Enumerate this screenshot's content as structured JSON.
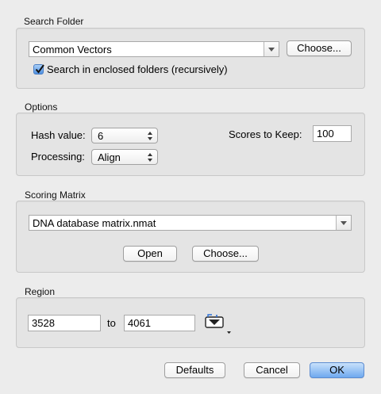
{
  "search_folder": {
    "label": "Search Folder",
    "folder_value": "Common Vectors",
    "choose_label": "Choose...",
    "recursive_label": "Search in enclosed folders (recursively)",
    "recursive_checked": true
  },
  "options": {
    "label": "Options",
    "hash_label": "Hash value:",
    "hash_value": "6",
    "processing_label": "Processing:",
    "processing_value": "Align",
    "scores_label": "Scores to Keep:",
    "scores_value": "100"
  },
  "scoring_matrix": {
    "label": "Scoring Matrix",
    "matrix_value": "DNA database matrix.nmat",
    "open_label": "Open",
    "choose_label": "Choose..."
  },
  "region": {
    "label": "Region",
    "from_value": "3528",
    "to_label": "to",
    "to_value": "4061",
    "selection_icon": "sequence-selection-icon"
  },
  "footer": {
    "defaults_label": "Defaults",
    "cancel_label": "Cancel",
    "ok_label": "OK"
  },
  "colors": {
    "accent": "#6fa9ef",
    "background": "#ececec"
  }
}
